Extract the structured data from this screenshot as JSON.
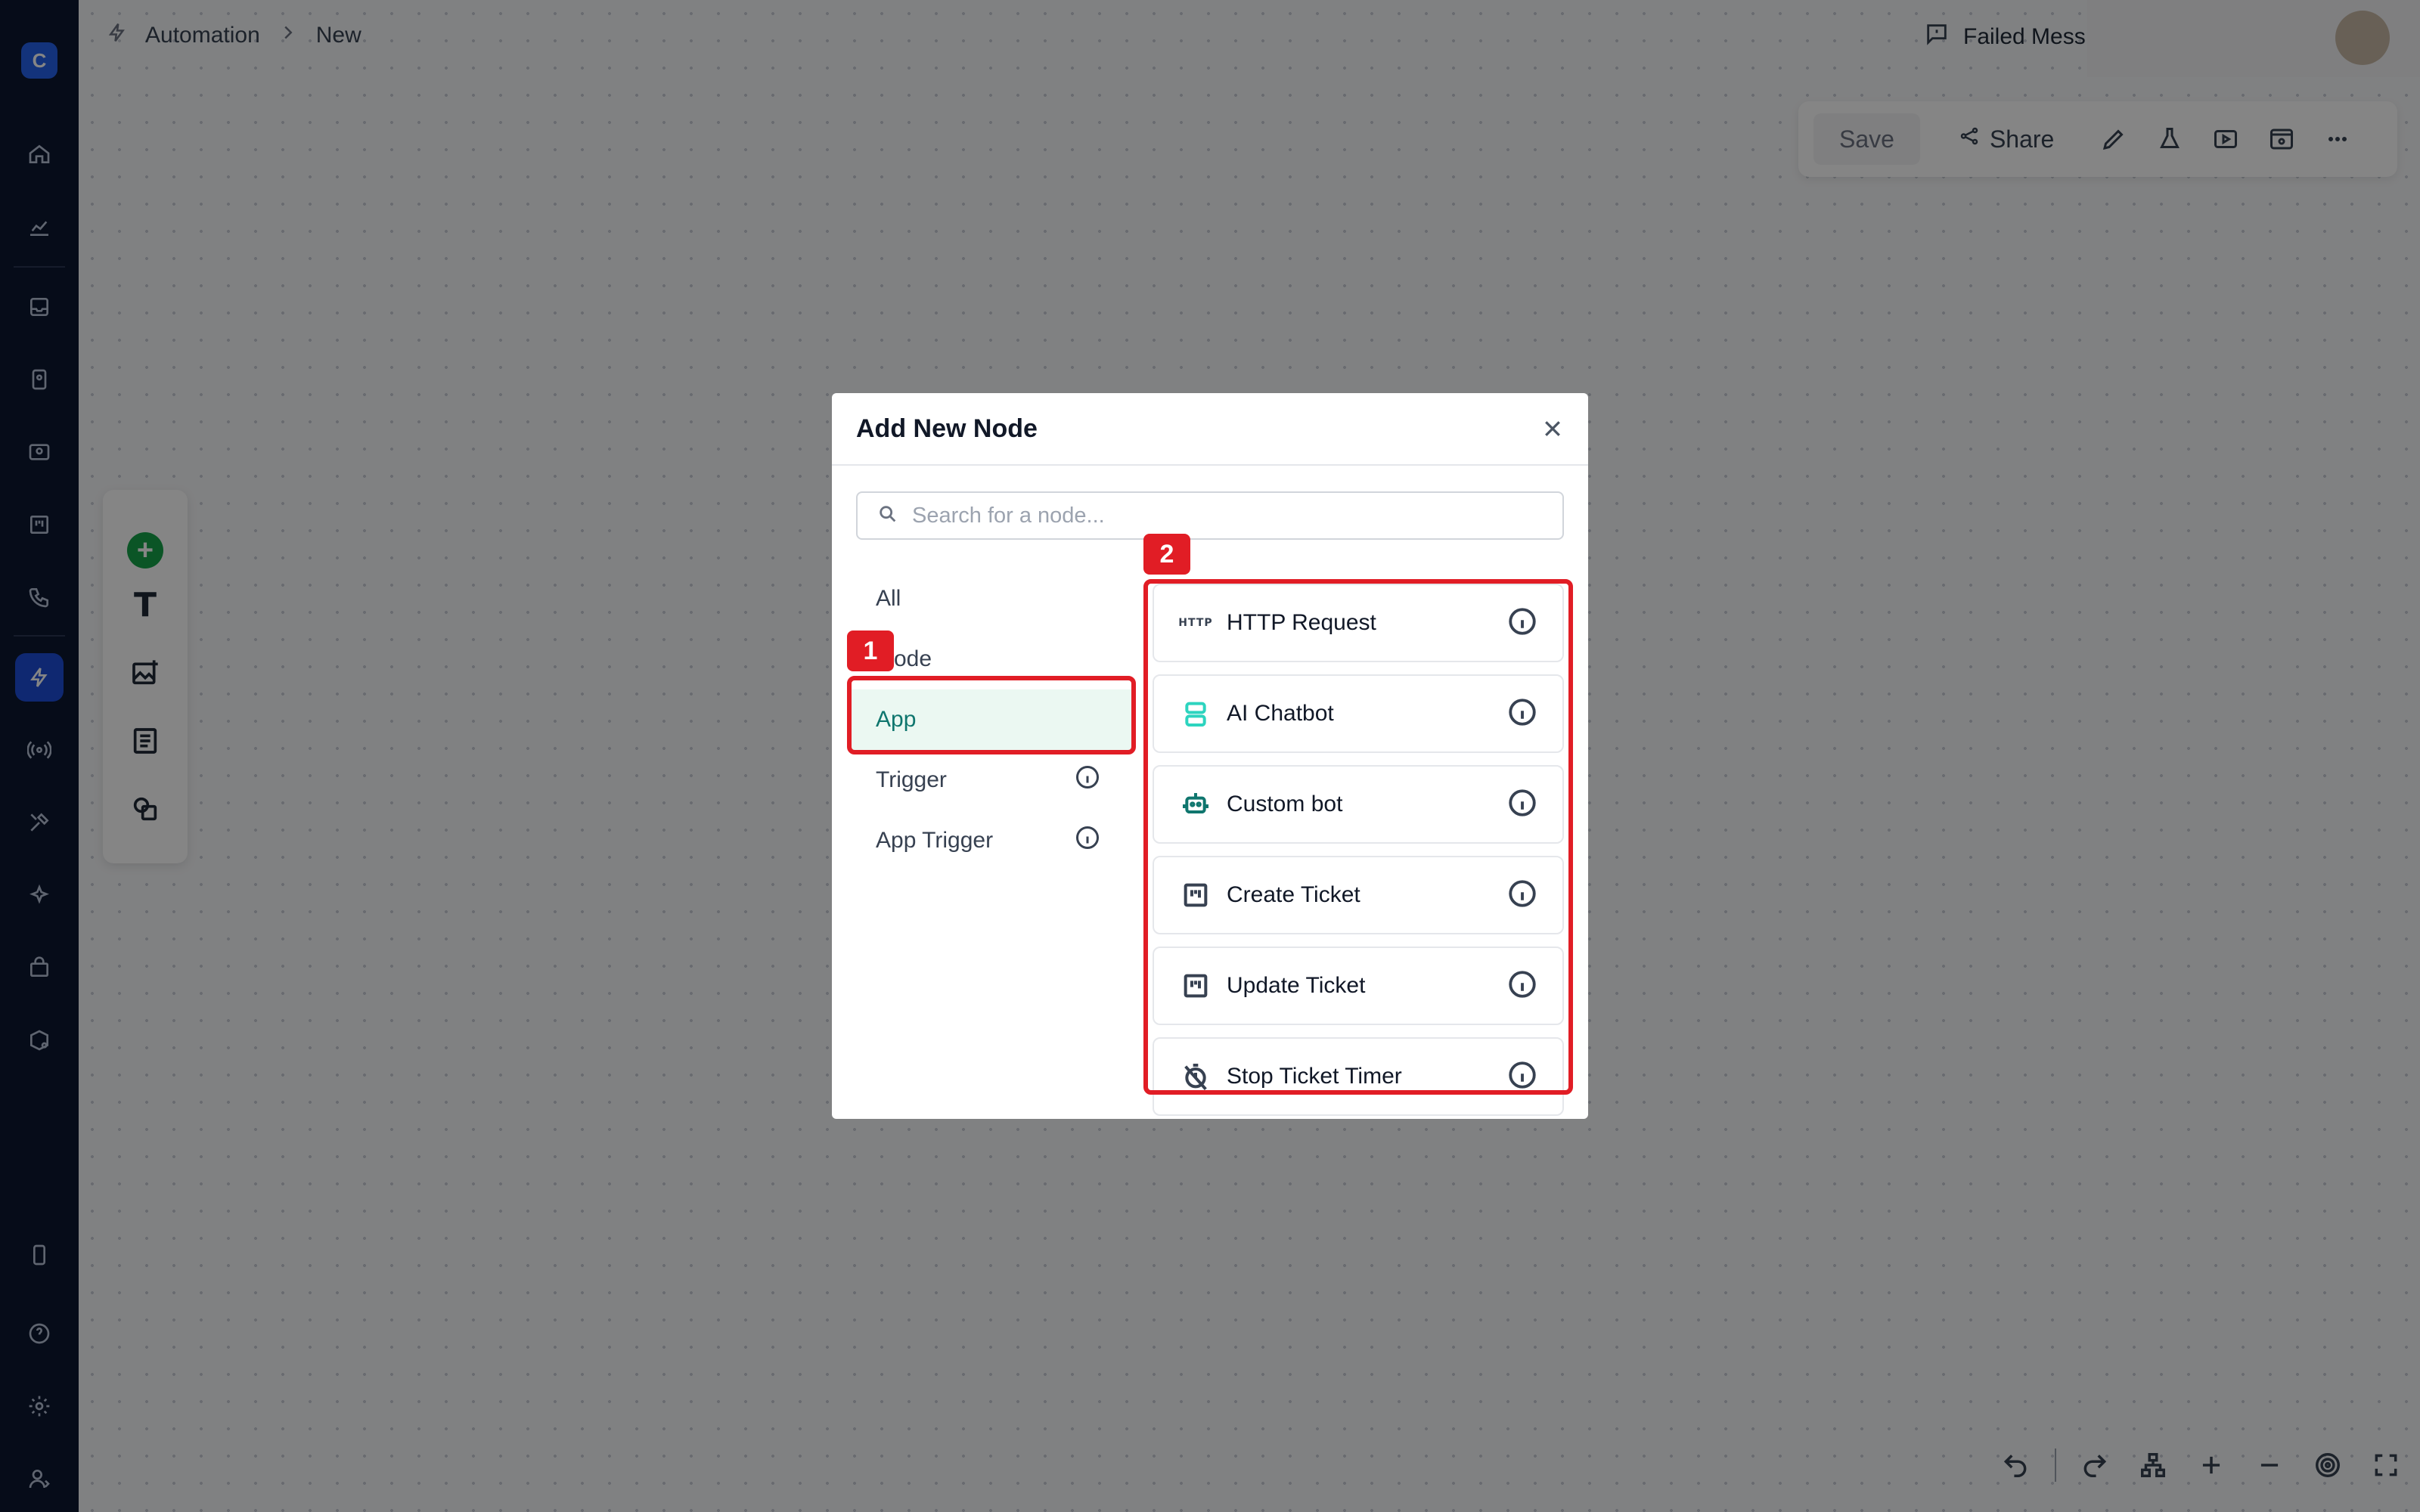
{
  "breadcrumb": {
    "root": "Automation",
    "current": "New"
  },
  "header": {
    "failed_messages": "Failed Mess"
  },
  "toolbar": {
    "save_label": "Save",
    "share_label": "Share"
  },
  "modal": {
    "title": "Add New Node",
    "search_placeholder": "Search for a node...",
    "categories": [
      {
        "label": "All"
      },
      {
        "label": "ode"
      },
      {
        "label": "App"
      },
      {
        "label": "Trigger"
      },
      {
        "label": "App Trigger"
      }
    ],
    "selected_category": "App",
    "nodes": [
      {
        "label": "HTTP Request",
        "icon": "http-icon"
      },
      {
        "label": "AI Chatbot",
        "icon": "ai-chatbot-icon"
      },
      {
        "label": "Custom bot",
        "icon": "robot-icon"
      },
      {
        "label": "Create Ticket",
        "icon": "ticket-board-icon"
      },
      {
        "label": "Update Ticket",
        "icon": "ticket-board-icon"
      },
      {
        "label": "Stop Ticket Timer",
        "icon": "timer-off-icon"
      }
    ],
    "http_glyph": "HTTP"
  },
  "annotations": {
    "badge_1": "1",
    "badge_2": "2"
  },
  "colors": {
    "accent_green": "#0f766e",
    "annotation_red": "#e11d25",
    "sidebar_bg": "#0d1730",
    "active_nav": "#1d4ed8"
  }
}
